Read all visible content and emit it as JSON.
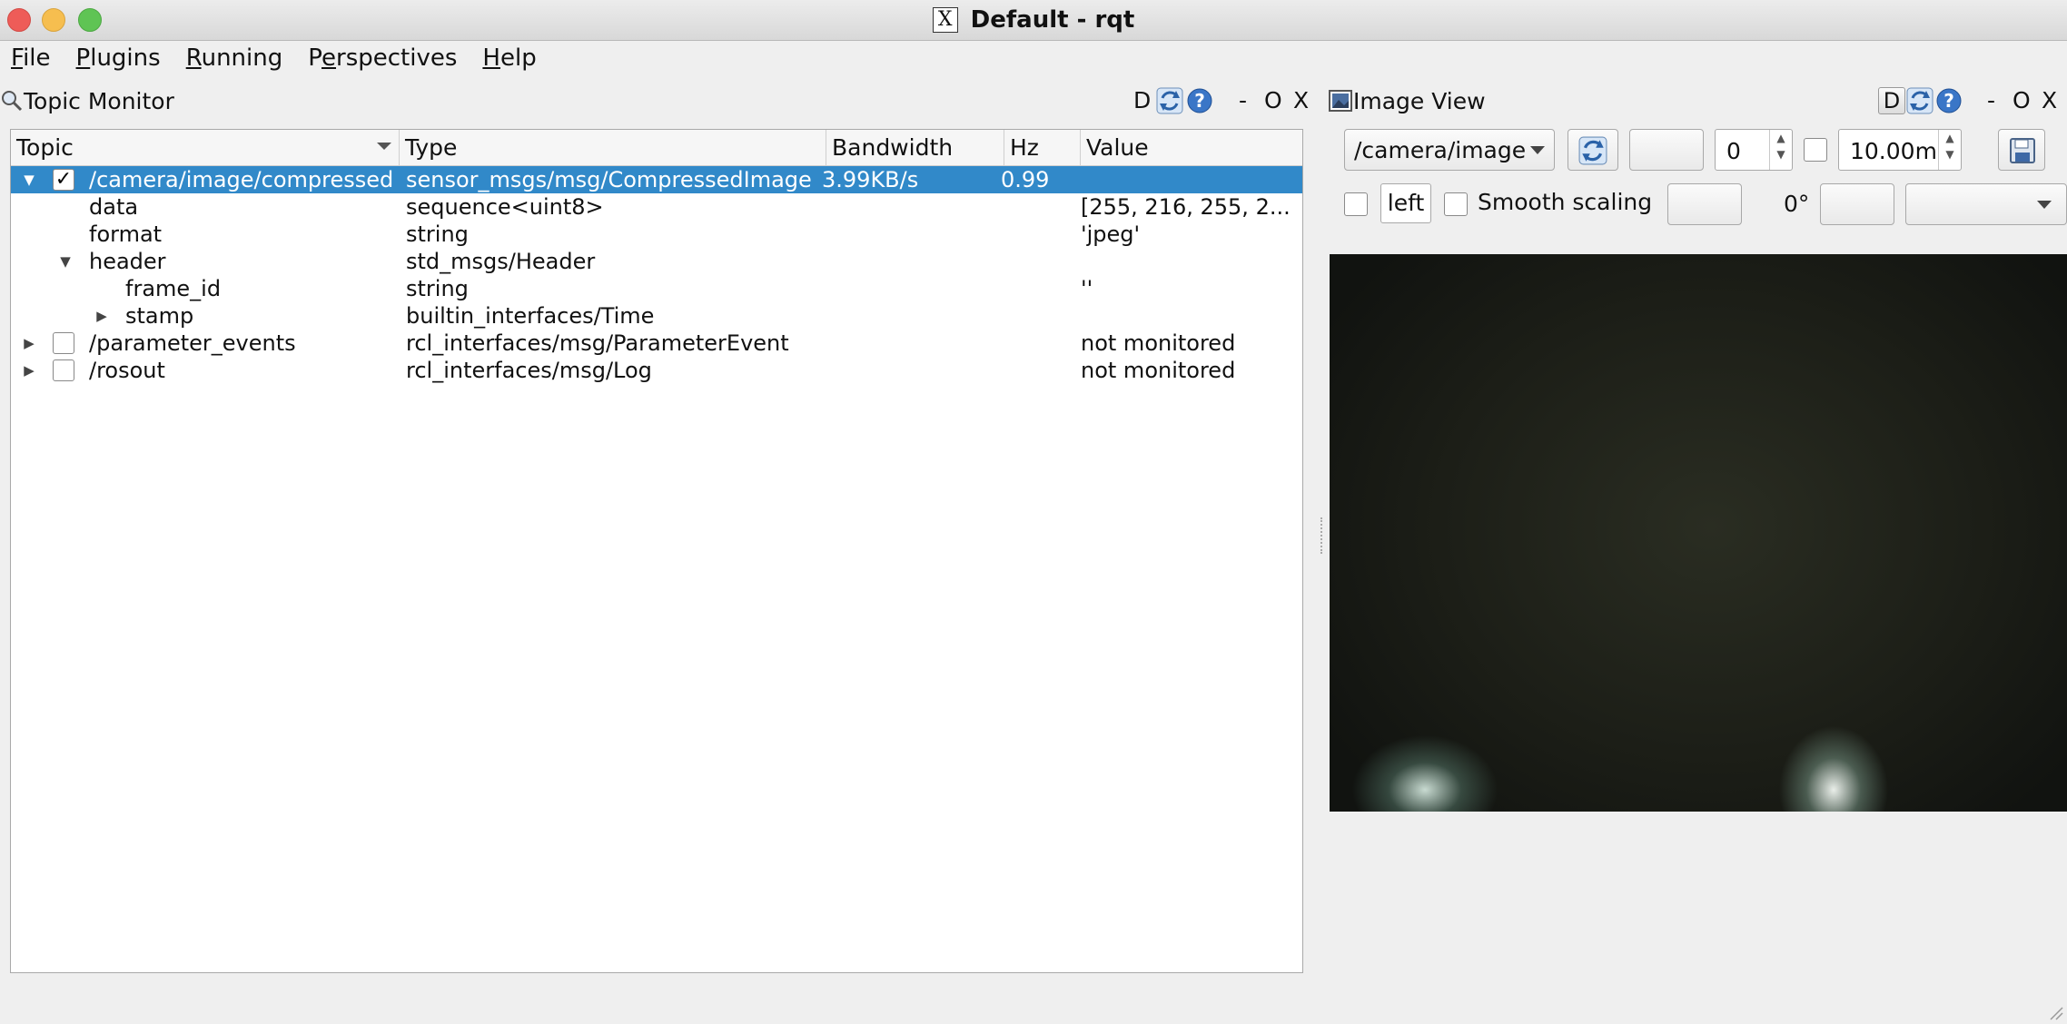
{
  "window": {
    "title": "Default - rqt",
    "x_glyph": "X"
  },
  "menu": [
    {
      "pre": "",
      "u": "F",
      "post": "ile"
    },
    {
      "pre": "",
      "u": "P",
      "post": "lugins"
    },
    {
      "pre": "",
      "u": "R",
      "post": "unning"
    },
    {
      "pre": "P",
      "u": "e",
      "post": "rspectives"
    },
    {
      "pre": "",
      "u": "H",
      "post": "elp"
    }
  ],
  "topic_monitor": {
    "title": "Topic Monitor",
    "d_label": "D",
    "min_label": "-",
    "float_label": "O",
    "close_label": "X",
    "columns": {
      "topic": "Topic",
      "type": "Type",
      "bandwidth": "Bandwidth",
      "hz": "Hz",
      "value": "Value"
    },
    "rows": [
      {
        "topic": "/camera/image/compressed",
        "type": "sensor_msgs/msg/CompressedImage",
        "bandwidth": "3.99KB/s",
        "hz": "0.99",
        "value": "",
        "checked": true,
        "expanded": true,
        "selected": true
      },
      {
        "topic": "data",
        "type": "sequence<uint8>",
        "bandwidth": "",
        "hz": "",
        "value": "[255, 216, 255, 2..."
      },
      {
        "topic": "format",
        "type": "string",
        "bandwidth": "",
        "hz": "",
        "value": "'jpeg'"
      },
      {
        "topic": "header",
        "type": "std_msgs/Header",
        "bandwidth": "",
        "hz": "",
        "value": "",
        "expanded": true
      },
      {
        "topic": "frame_id",
        "type": "string",
        "bandwidth": "",
        "hz": "",
        "value": "''"
      },
      {
        "topic": "stamp",
        "type": "builtin_interfaces/Time",
        "bandwidth": "",
        "hz": "",
        "value": "",
        "expanded": false
      },
      {
        "topic": "/parameter_events",
        "type": "rcl_interfaces/msg/ParameterEvent",
        "bandwidth": "",
        "hz": "",
        "value": "not monitored",
        "checked": false,
        "expanded": false
      },
      {
        "topic": "/rosout",
        "type": "rcl_interfaces/msg/Log",
        "bandwidth": "",
        "hz": "",
        "value": "not monitored",
        "checked": false,
        "expanded": false
      }
    ]
  },
  "image_view": {
    "title": "Image View",
    "d_label": "D",
    "min_label": "-",
    "float_label": "O",
    "close_label": "X",
    "topic_selected": "/camera/image",
    "spin_value": "0",
    "duration_value": "10.00m",
    "left_value": "left",
    "smooth_scaling_label": "Smooth scaling",
    "rotation_label": "0°"
  },
  "colors": {
    "selection": "#3189c9",
    "close": "#ee5c58",
    "minimize": "#f6be4f",
    "maximize": "#5fc454"
  }
}
